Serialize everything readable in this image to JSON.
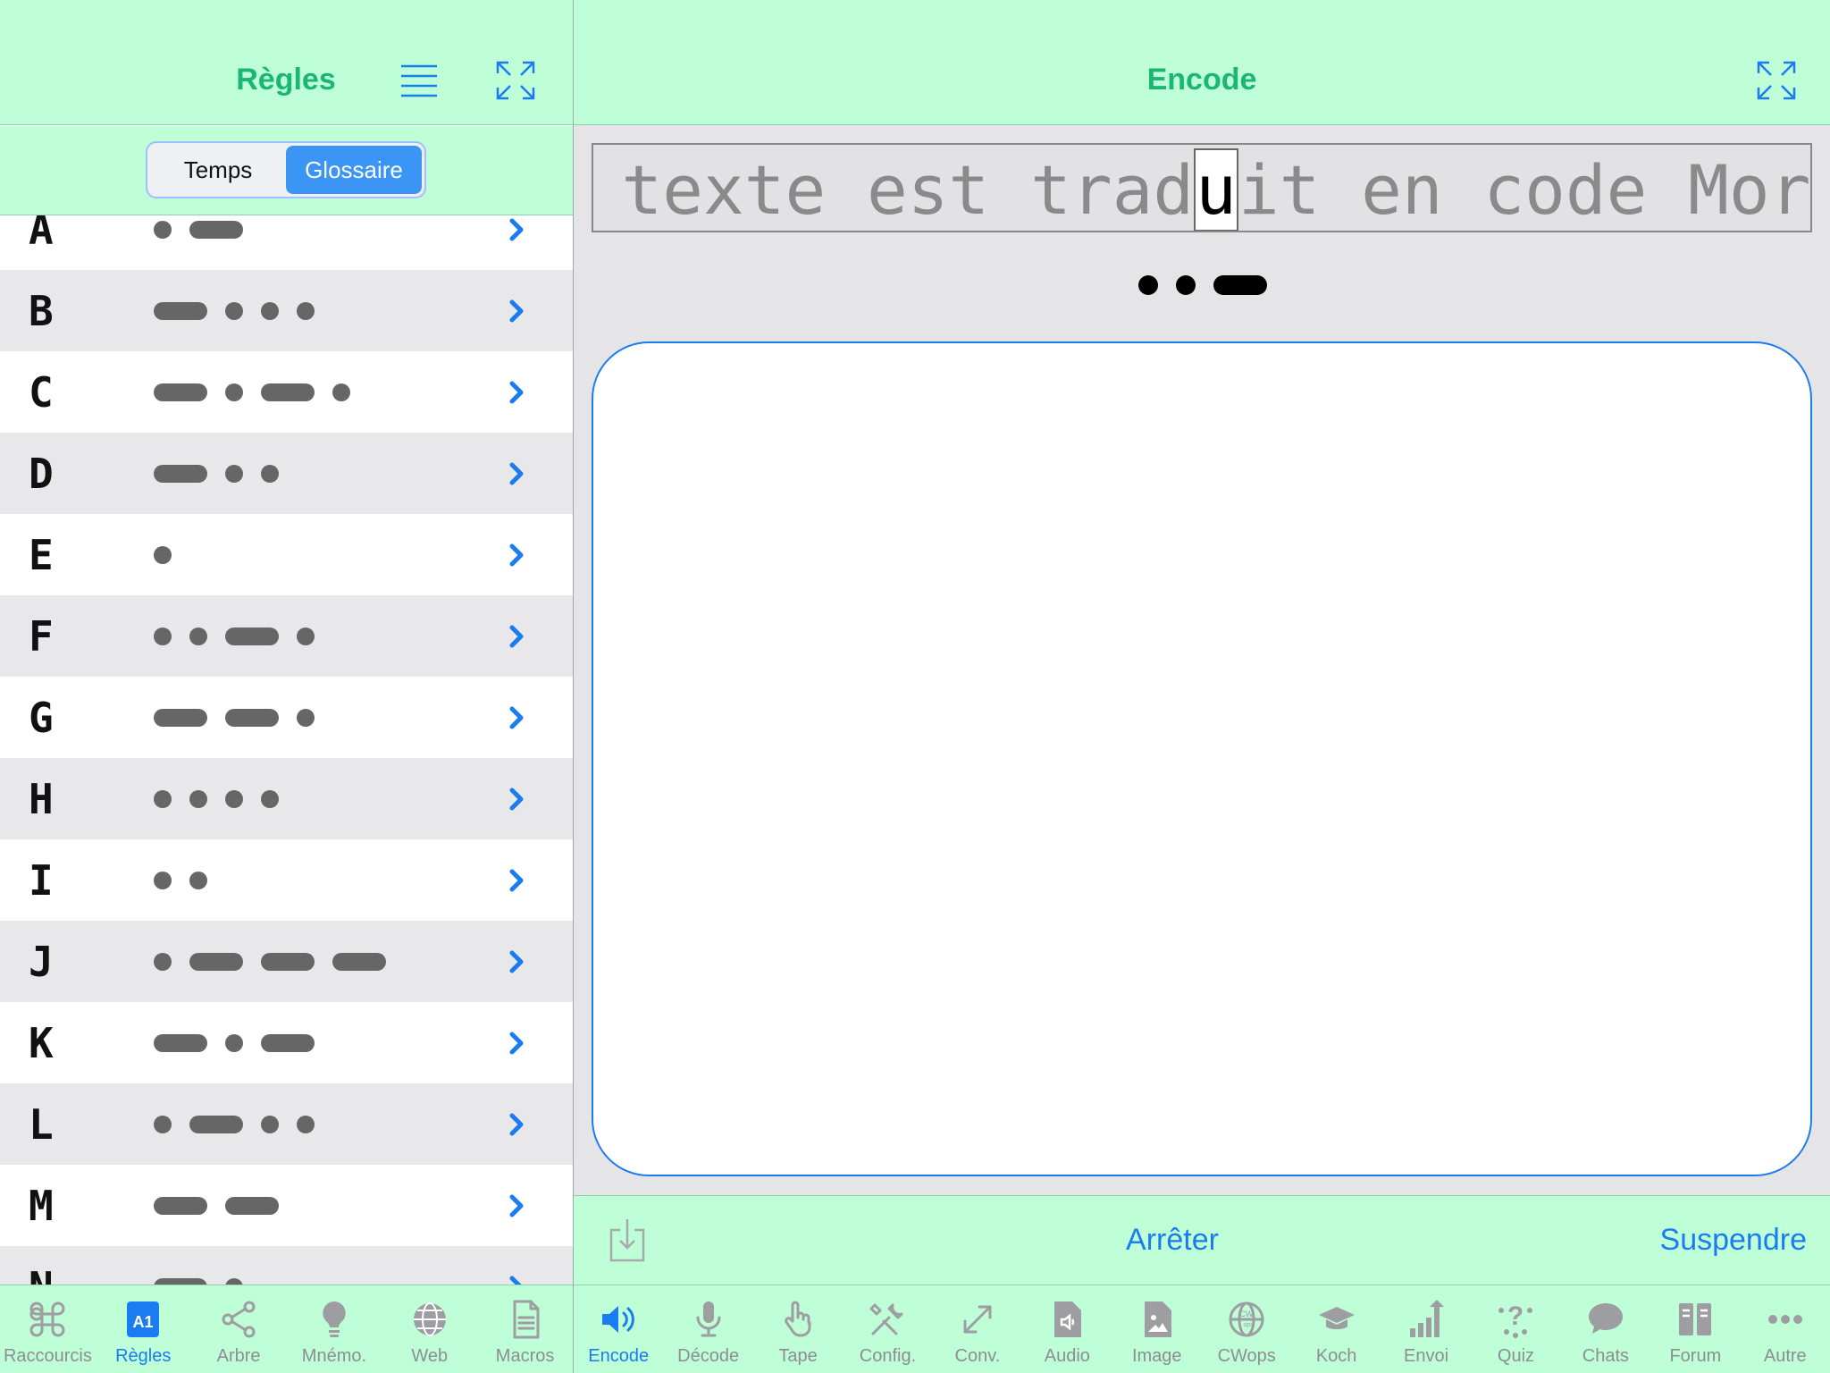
{
  "left_header": {
    "title": "Règles"
  },
  "segment": {
    "options": [
      "Temps",
      "Glossaire"
    ],
    "selected": "Glossaire"
  },
  "rules": [
    {
      "letter": "A",
      "code": ".-"
    },
    {
      "letter": "B",
      "code": "-..."
    },
    {
      "letter": "C",
      "code": "-.-."
    },
    {
      "letter": "D",
      "code": "-.."
    },
    {
      "letter": "E",
      "code": "."
    },
    {
      "letter": "F",
      "code": "..-."
    },
    {
      "letter": "G",
      "code": "--."
    },
    {
      "letter": "H",
      "code": "...."
    },
    {
      "letter": "I",
      "code": ".."
    },
    {
      "letter": "J",
      "code": ".---"
    },
    {
      "letter": "K",
      "code": "-.-"
    },
    {
      "letter": "L",
      "code": ".-.."
    },
    {
      "letter": "M",
      "code": "--"
    },
    {
      "letter": "N",
      "code": "-."
    }
  ],
  "right_header": {
    "title": "Encode"
  },
  "encode": {
    "text_before": "e texte est trad",
    "current_char": "u",
    "text_after": "it en code Morse",
    "current_code": "..-"
  },
  "actions": {
    "stop": "Arrêter",
    "pause": "Suspendre"
  },
  "left_tabs": [
    {
      "label": "Raccourcis",
      "icon": "command-icon",
      "active": false
    },
    {
      "label": "Règles",
      "icon": "rules-a1-icon",
      "active": true
    },
    {
      "label": "Arbre",
      "icon": "tree-share-icon",
      "active": false
    },
    {
      "label": "Mnémo.",
      "icon": "lightbulb-icon",
      "active": false
    },
    {
      "label": "Web",
      "icon": "globe-icon",
      "active": false
    },
    {
      "label": "Macros",
      "icon": "document-icon",
      "active": false
    }
  ],
  "right_tabs": [
    {
      "label": "Encode",
      "icon": "speaker-icon",
      "active": true
    },
    {
      "label": "Décode",
      "icon": "microphone-icon",
      "active": false
    },
    {
      "label": "Tape",
      "icon": "hand-tap-icon",
      "active": false
    },
    {
      "label": "Config.",
      "icon": "tools-icon",
      "active": false
    },
    {
      "label": "Conv.",
      "icon": "convert-arrows-icon",
      "active": false
    },
    {
      "label": "Audio",
      "icon": "audio-file-icon",
      "active": false
    },
    {
      "label": "Image",
      "icon": "image-file-icon",
      "active": false
    },
    {
      "label": "CWops",
      "icon": "cwops-globe-icon",
      "active": false
    },
    {
      "label": "Koch",
      "icon": "graduation-cap-icon",
      "active": false
    },
    {
      "label": "Envoi",
      "icon": "send-chart-icon",
      "active": false
    },
    {
      "label": "Quiz",
      "icon": "quiz-icon",
      "active": false
    },
    {
      "label": "Chats",
      "icon": "chat-bubble-icon",
      "active": false
    },
    {
      "label": "Forum",
      "icon": "forum-icon",
      "active": false
    },
    {
      "label": "Autre",
      "icon": "more-dots-icon",
      "active": false
    }
  ]
}
